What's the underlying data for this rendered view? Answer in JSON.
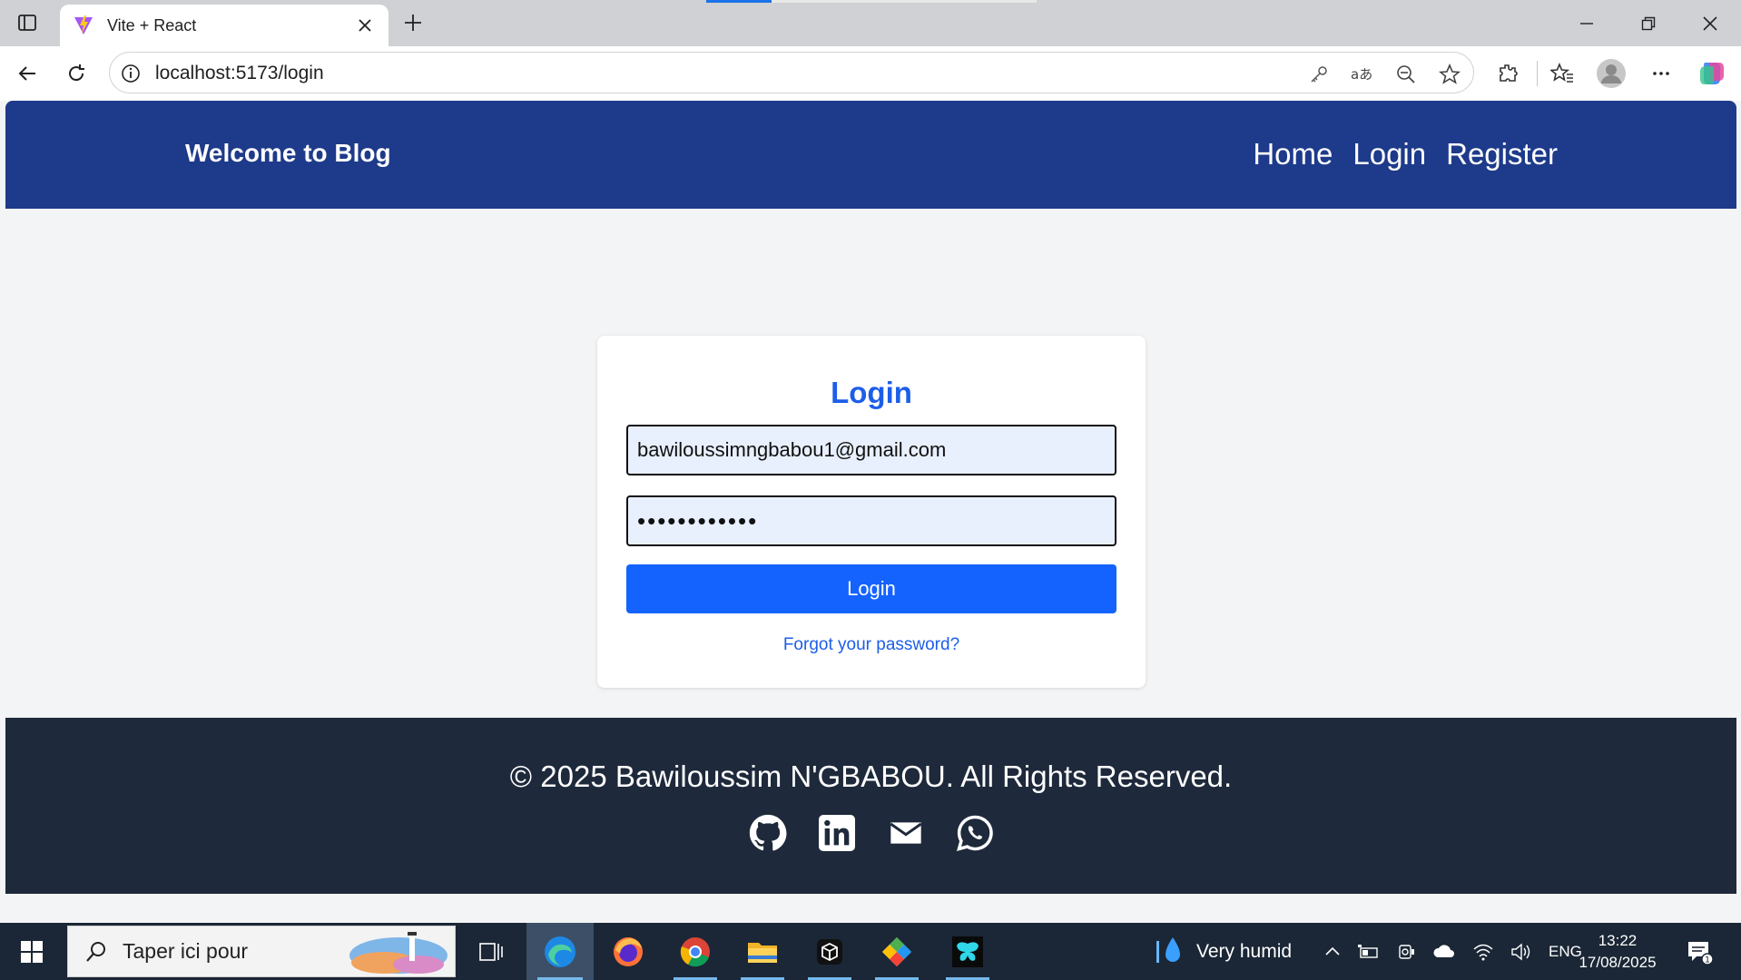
{
  "browser": {
    "tab_title": "Vite + React",
    "url": "localhost:5173/login"
  },
  "nav": {
    "brand": "Welcome to Blog",
    "links": [
      "Home",
      "Login",
      "Register"
    ]
  },
  "login": {
    "title": "Login",
    "email_value": "bawiloussimngbabou1@gmail.com",
    "password_value": "••••••••••••",
    "button_label": "Login",
    "forgot_label": "Forgot your password?"
  },
  "footer": {
    "copyright": "© 2025 Bawiloussim N'GBABOU. All Rights Reserved.",
    "socials": [
      "github-icon",
      "linkedin-icon",
      "mail-icon",
      "whatsapp-icon"
    ]
  },
  "taskbar": {
    "search_placeholder": "Taper ici pour",
    "weather": "Very humid",
    "language": "ENG",
    "time": "13:22",
    "date": "17/08/2025",
    "notification_count": "1"
  },
  "colors": {
    "nav_bg": "#1e3a8a",
    "accent": "#1463ff",
    "footer_bg": "#1e293b"
  }
}
